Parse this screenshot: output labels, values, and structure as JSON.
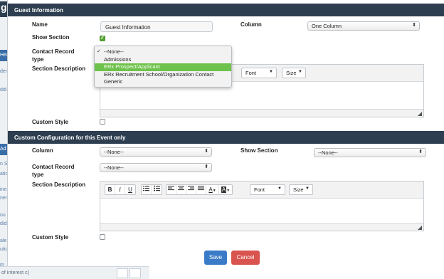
{
  "background": {
    "title_fragment": "ge",
    "tabs": [
      "Hea",
      "Ad"
    ],
    "fragments": [
      "den",
      "ddi",
      "n S",
      "atic",
      "ine",
      "nen",
      "ou h",
      "didi",
      "ale",
      "utio",
      "m"
    ],
    "bottom_text": "of  Interest    c)"
  },
  "guest_section": {
    "header": "Guest Information",
    "name_label": "Name",
    "name_value": "Guest Information",
    "column_label": "Column",
    "column_value": "One Column",
    "show_section_label": "Show Section",
    "show_section_checked": true,
    "contact_record_label": "Contact Record",
    "contact_record_label2": "type",
    "section_description_label": "Section Description",
    "custom_style_label": "Custom Style",
    "custom_style_checked": false,
    "toolbar": {
      "font": "Font",
      "size": "Size"
    }
  },
  "dropdown": {
    "options": [
      "--None--",
      "Admissions",
      "ERx Prospect/Applicant",
      "ERx Recruitment School/Organization Contact",
      "Generic"
    ],
    "checked_index": 0,
    "highlighted_index": 2
  },
  "custom_section": {
    "header": "Custom Configuration for this Event only",
    "column_label": "Column",
    "column_value": "--None--",
    "show_section_label": "Show Section",
    "show_section_value": "--None--",
    "contact_record_label": "Contact Record",
    "contact_record_label2": "type",
    "contact_record_value": "--None--",
    "section_description_label": "Section Description",
    "custom_style_label": "Custom Style",
    "custom_style_checked": false,
    "toolbar": {
      "bold": "B",
      "italic": "I",
      "underline": "U",
      "font_color": "A",
      "bg_color": "A",
      "font": "Font",
      "size": "Size"
    }
  },
  "buttons": {
    "save": "Save",
    "cancel": "Cancel"
  },
  "colors": {
    "header": "#2d3e50",
    "highlight": "#6ec24b",
    "save": "#3a7bc8",
    "cancel": "#d9534f",
    "check": "#55a532"
  }
}
